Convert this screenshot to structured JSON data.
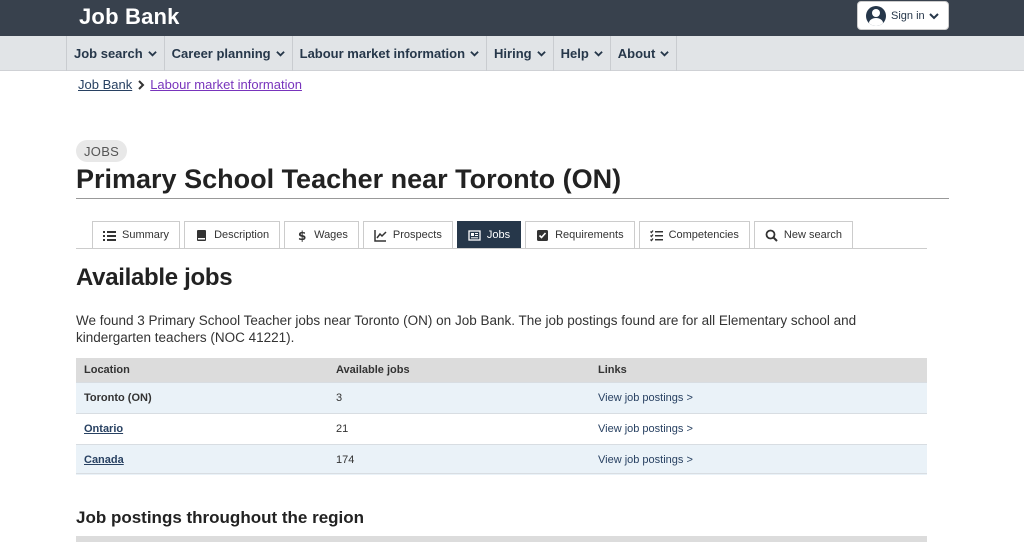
{
  "header": {
    "brand": "Job Bank",
    "signin_label": "Sign in"
  },
  "menu": {
    "items": [
      {
        "label": "Job search"
      },
      {
        "label": "Career planning"
      },
      {
        "label": "Labour market information"
      },
      {
        "label": "Hiring"
      },
      {
        "label": "Help"
      },
      {
        "label": "About"
      }
    ]
  },
  "breadcrumb": {
    "home": "Job Bank",
    "current": "Labour market information"
  },
  "page": {
    "tag": "JOBS",
    "title": "Primary School Teacher near Toronto (ON)"
  },
  "tabs": [
    {
      "label": "Summary",
      "icon": "list-icon"
    },
    {
      "label": "Description",
      "icon": "book-icon"
    },
    {
      "label": "Wages",
      "icon": "dollar-icon"
    },
    {
      "label": "Prospects",
      "icon": "line-chart-icon"
    },
    {
      "label": "Jobs",
      "icon": "newspaper-icon",
      "active": true
    },
    {
      "label": "Requirements",
      "icon": "checkbox-icon"
    },
    {
      "label": "Competencies",
      "icon": "checklist-icon"
    },
    {
      "label": "New search",
      "icon": "search-icon"
    }
  ],
  "section": {
    "heading": "Available jobs",
    "intro": "We found 3 Primary School Teacher jobs near Toronto (ON) on Job Bank. The job postings found are for all Elementary school and kindergarten teachers (NOC 41221)."
  },
  "table": {
    "headers": [
      "Location",
      "Available jobs",
      "Links"
    ],
    "rows": [
      {
        "location": "Toronto (ON)",
        "jobs": "3",
        "link": "View job postings >"
      },
      {
        "location": "Ontario",
        "jobs": "21",
        "link": "View job postings >"
      },
      {
        "location": "Canada",
        "jobs": "174",
        "link": "View job postings >"
      }
    ]
  },
  "subsection": {
    "heading": "Job postings throughout the region"
  },
  "colors": {
    "topbar": "#38414d",
    "navy": "#26374a",
    "link": "#284162",
    "visited": "#7834bc"
  }
}
